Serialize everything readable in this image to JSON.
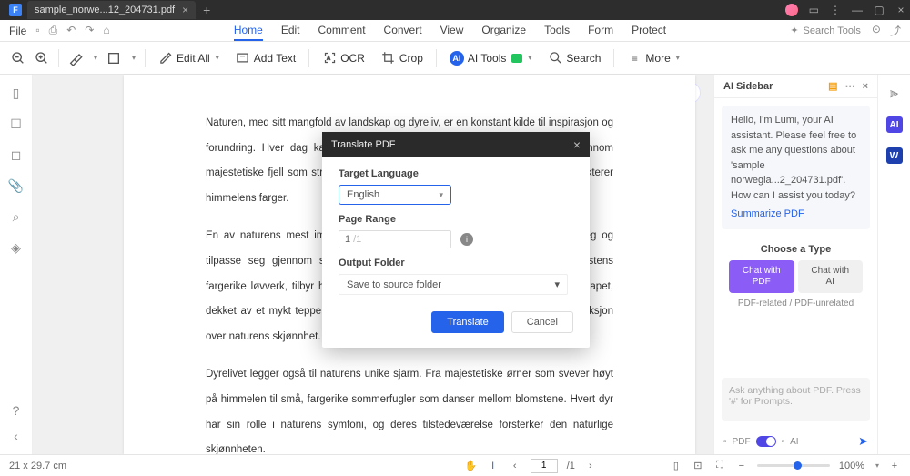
{
  "tab": {
    "title": "sample_norwe...12_204731.pdf"
  },
  "menus": {
    "file": "File",
    "items": [
      "Home",
      "Edit",
      "Comment",
      "Convert",
      "View",
      "Organize",
      "Tools",
      "Form",
      "Protect"
    ],
    "search_tools": "Search Tools"
  },
  "toolbar": {
    "edit_all": "Edit All",
    "add_text": "Add Text",
    "ocr": "OCR",
    "crop": "Crop",
    "ai_tools": "AI Tools",
    "search": "Search",
    "more": "More"
  },
  "document": {
    "p1": "Naturen, med sitt mangfold av landskap og dyreliv, er en konstant kilde til inspirasjon og forundring. Hver dag kan vi oppleve naturens underverker, enten det er gjennom majestetiske fjell som strekker seg mot himmelen, eller rolige innsjøer som reflekterer himmelens farger.",
    "p2": "En av naturens mest imponerende egenskaper er dens evne til å forandre seg og tilpasse seg gjennom sesongene. Fra det blomstrende vårlandskapet til høstens fargerike løvverk, tilbyr hver sesong sin egen unike skjønnhet. Selv vinterlandskapet, dekket av et mykt teppe av snø, har en egen stillhet og ro som inviterer til refleksjon over naturens skjønnhet.",
    "p3": "Dyrelivet legger også til naturens unike sjarm. Fra majestetiske ørner som svever høyt på himmelen til små, fargerike sommerfugler som danser mellom blomstene. Hvert dyr har sin rolle i naturens symfoni, og deres tilstedeværelse forsterker den naturlige skjønnheten."
  },
  "sidebar": {
    "title": "AI Sidebar",
    "greeting": "Hello, I'm Lumi, your AI assistant. Please feel free to ask me any questions about 'sample norwegia...2_204731.pdf'. How can I assist you today?",
    "summarize_link": "Summarize PDF",
    "choose_type": "Choose a Type",
    "chat_pdf_l1": "Chat with",
    "chat_pdf_l2": "PDF",
    "chat_ai_l1": "Chat with",
    "chat_ai_l2": "AI",
    "type_note": "PDF-related / PDF-unrelated",
    "ask_placeholder": "Ask anything about PDF. Press '#' for Prompts.",
    "footer_pdf": "PDF",
    "footer_ai": "AI"
  },
  "modal": {
    "title": "Translate PDF",
    "target_lang_label": "Target Language",
    "target_lang_value": "English",
    "page_range_label": "Page Range",
    "page_range_value": "1",
    "page_range_hint": "/1",
    "output_label": "Output Folder",
    "output_value": "Save to source folder",
    "translate_btn": "Translate",
    "cancel_btn": "Cancel"
  },
  "status": {
    "dimensions": "21 x 29.7 cm",
    "page_current": "1",
    "page_total": "/1",
    "zoom": "100%"
  }
}
